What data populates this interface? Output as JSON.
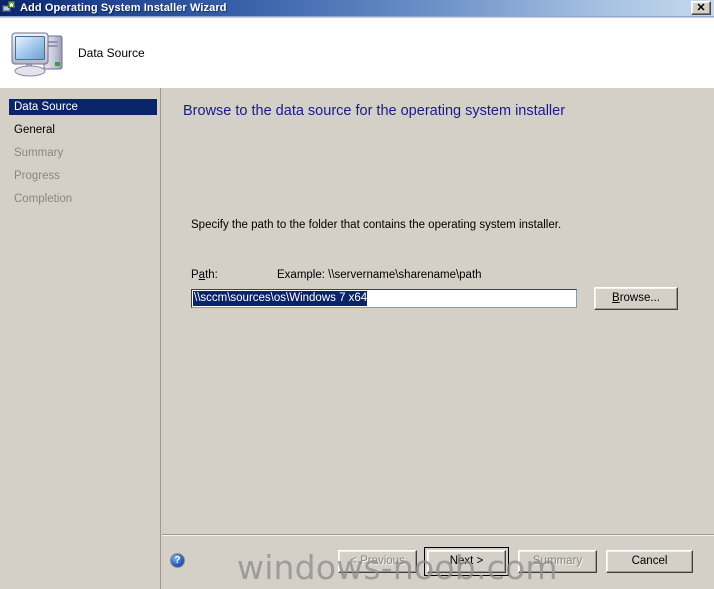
{
  "window": {
    "title": "Add Operating System Installer Wizard",
    "title_icon": "computer-add-icon",
    "close_label": "✕",
    "titlebar_color": "#0a246a",
    "face_color": "#d4d0c8"
  },
  "header": {
    "icon": "computer-icon",
    "title": "Data Source"
  },
  "sidebar": {
    "items": [
      {
        "label": "Data Source",
        "state": "selected"
      },
      {
        "label": "General",
        "state": "enabled"
      },
      {
        "label": "Summary",
        "state": "disabled"
      },
      {
        "label": "Progress",
        "state": "disabled"
      },
      {
        "label": "Completion",
        "state": "disabled"
      }
    ],
    "selected_color": "#0a246a"
  },
  "content": {
    "heading": "Browse to the data source for the operating system installer",
    "heading_color": "#1a1a8c",
    "instruction": "Specify the path to the folder that contains the operating system installer.",
    "path_label_prefix": "P",
    "path_label_accel": "a",
    "path_label_suffix": "th:",
    "path_example": "Example: \\\\servername\\sharename\\path",
    "path_value": "\\\\sccm\\sources\\os\\Windows 7 x64",
    "path_placeholder": "",
    "path_selected": true,
    "browse": {
      "prefix": "",
      "accel": "B",
      "suffix": "rowse..."
    }
  },
  "footer": {
    "help_icon": "help-question-icon",
    "help_glyph": "?",
    "buttons": [
      {
        "name": "previous",
        "text": "< Previous",
        "accel": "P",
        "enabled": false
      },
      {
        "name": "next",
        "text": "Next >",
        "accel": "N",
        "enabled": true,
        "default": true
      },
      {
        "name": "summary",
        "text": "Summary",
        "accel": "S",
        "enabled": false
      },
      {
        "name": "cancel",
        "text": "Cancel",
        "accel": "",
        "enabled": true
      }
    ]
  },
  "watermark": {
    "text": "windows-noob.com"
  }
}
